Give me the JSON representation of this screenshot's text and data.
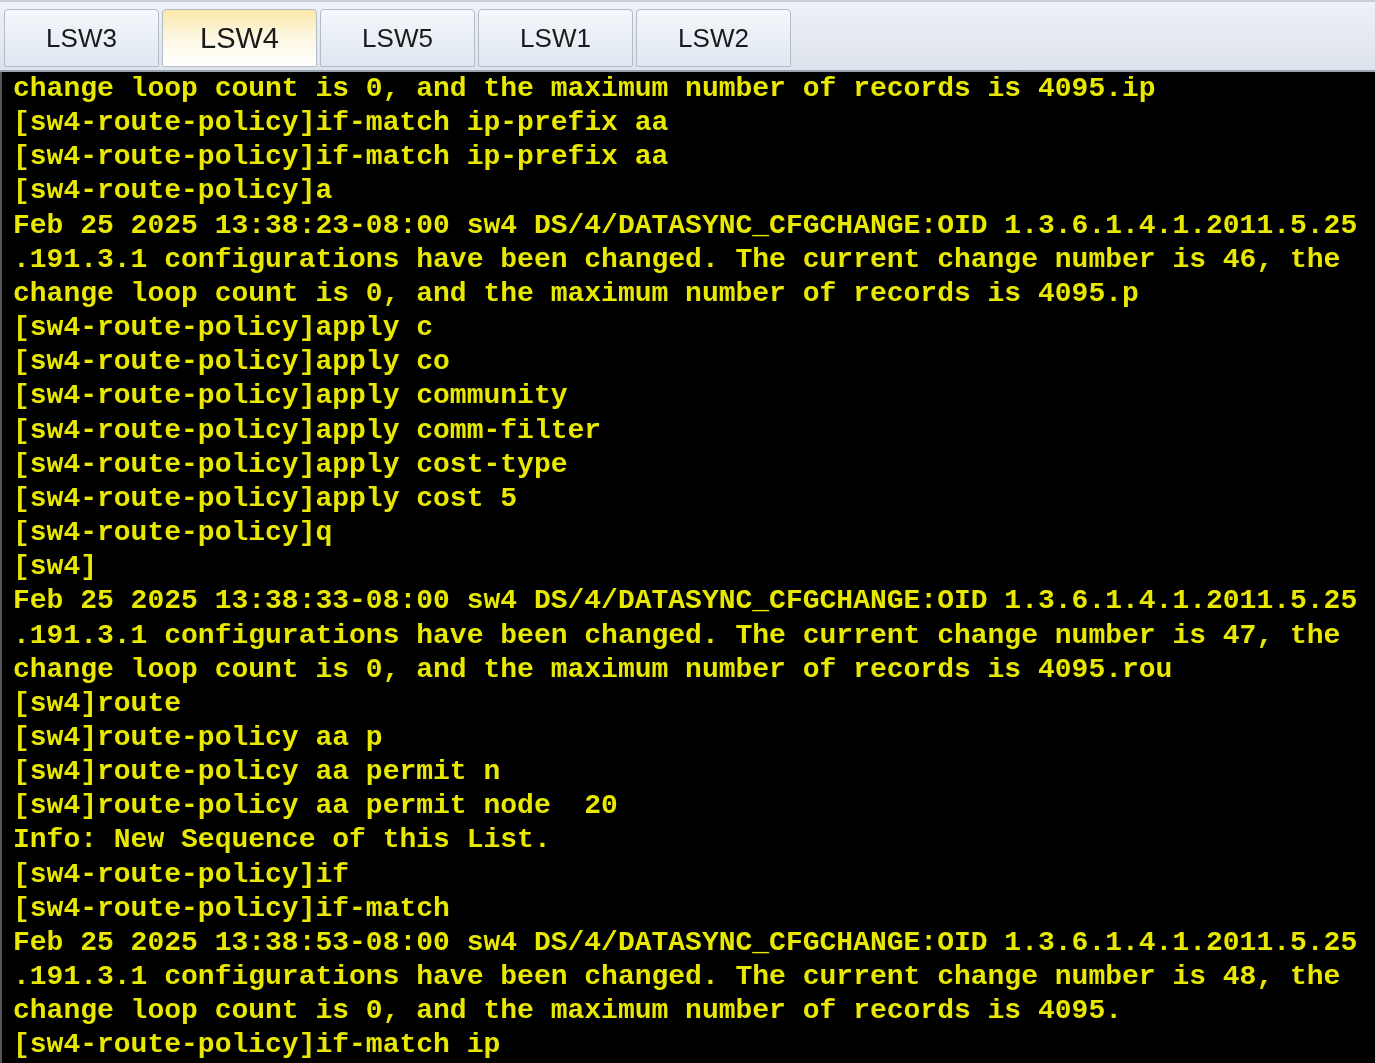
{
  "tabs": [
    {
      "label": "LSW3",
      "selected": false
    },
    {
      "label": "LSW4",
      "selected": true
    },
    {
      "label": "LSW5",
      "selected": false
    },
    {
      "label": "LSW1",
      "selected": false
    },
    {
      "label": "LSW2",
      "selected": false
    }
  ],
  "terminal_lines": [
    "change loop count is 0, and the maximum number of records is 4095.ip",
    "[sw4-route-policy]if-match ip-prefix aa",
    "[sw4-route-policy]if-match ip-prefix aa",
    "[sw4-route-policy]a",
    "Feb 25 2025 13:38:23-08:00 sw4 DS/4/DATASYNC_CFGCHANGE:OID 1.3.6.1.4.1.2011.5.25",
    ".191.3.1 configurations have been changed. The current change number is 46, the",
    "change loop count is 0, and the maximum number of records is 4095.p",
    "[sw4-route-policy]apply c",
    "[sw4-route-policy]apply co",
    "[sw4-route-policy]apply community",
    "[sw4-route-policy]apply comm-filter",
    "[sw4-route-policy]apply cost-type",
    "[sw4-route-policy]apply cost 5",
    "[sw4-route-policy]q",
    "[sw4]",
    "Feb 25 2025 13:38:33-08:00 sw4 DS/4/DATASYNC_CFGCHANGE:OID 1.3.6.1.4.1.2011.5.25",
    ".191.3.1 configurations have been changed. The current change number is 47, the",
    "change loop count is 0, and the maximum number of records is 4095.rou",
    "[sw4]route",
    "[sw4]route-policy aa p",
    "[sw4]route-policy aa permit n",
    "[sw4]route-policy aa permit node  20",
    "Info: New Sequence of this List.",
    "[sw4-route-policy]if",
    "[sw4-route-policy]if-match",
    "Feb 25 2025 13:38:53-08:00 sw4 DS/4/DATASYNC_CFGCHANGE:OID 1.3.6.1.4.1.2011.5.25",
    ".191.3.1 configurations have been changed. The current change number is 48, the",
    "change loop count is 0, and the maximum number of records is 4095.",
    "[sw4-route-policy]if-match ip"
  ]
}
